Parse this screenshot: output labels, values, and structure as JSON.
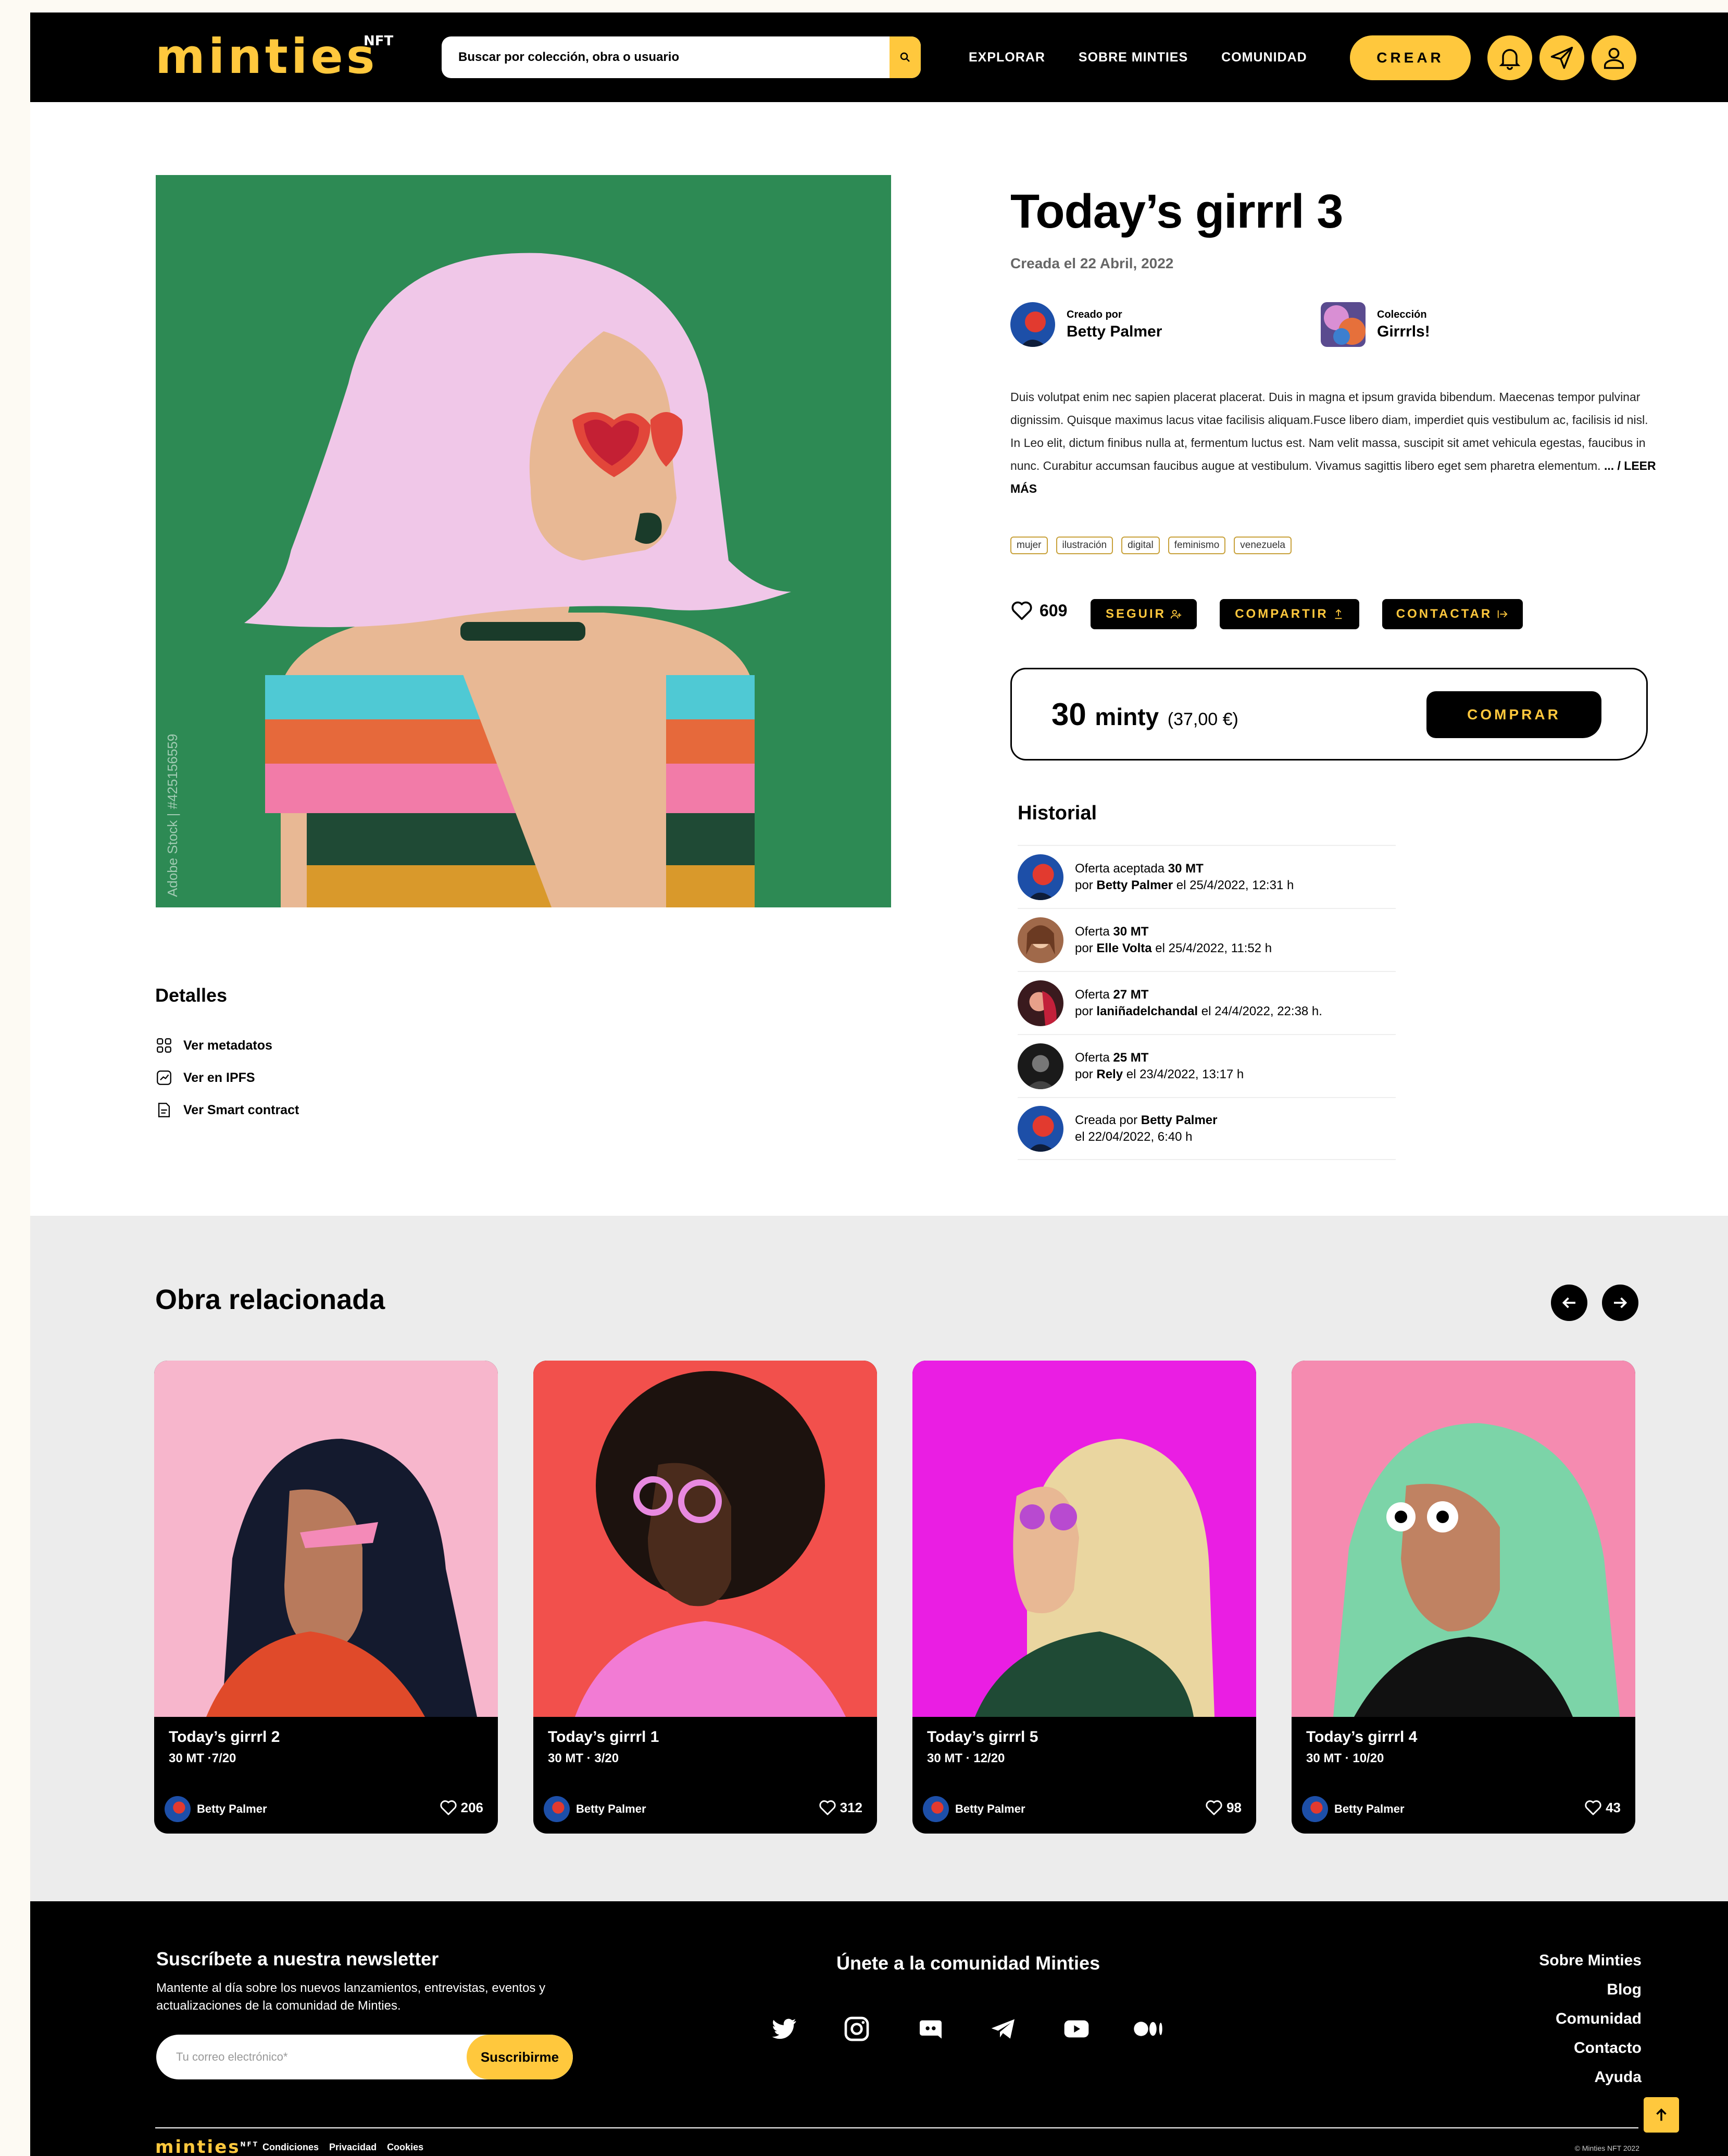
{
  "header": {
    "logo": "minties",
    "logo_sup": "NFT",
    "search_placeholder": "Buscar por colección, obra o usuario",
    "nav": [
      "EXPLORAR",
      "SOBRE MINTIES",
      "COMUNIDAD"
    ],
    "create_label": "CREAR",
    "icons": [
      "search-icon",
      "bell-icon",
      "send-icon",
      "user-icon"
    ]
  },
  "artwork": {
    "watermark": "Adobe Stock | #425156559",
    "background_color": "#2d8a54"
  },
  "details": {
    "title": "Detalles",
    "links": [
      "Ver metadatos",
      "Ver en IPFS",
      "Ver Smart contract"
    ]
  },
  "item": {
    "title": "Today’s girrrl 3",
    "created": "Creada el 22 Abril, 2022",
    "creator_label": "Creado por",
    "creator_name": "Betty Palmer",
    "collection_label": "Colección",
    "collection_name": "Girrrls!",
    "description": "Duis volutpat enim nec sapien placerat placerat. Duis in magna et ipsum gravida bibendum. Maecenas tempor pulvinar dignissim. Quisque maximus lacus vitae facilisis aliquam.Fusce libero diam, imperdiet quis vestibulum ac, facilisis id nisl. In Leo elit, dictum finibus nulla at, fermentum luctus est. Nam velit massa, suscipit sit amet vehicula egestas, faucibus in nunc. Curabitur accumsan faucibus augue at vestibulum. Vivamus sagittis libero eget sem pharetra elementum.",
    "read_more": "... / LEER MÁS",
    "tags": [
      "mujer",
      "ilustración",
      "digital",
      "feminismo",
      "venezuela"
    ],
    "likes": "609",
    "follow_label": "SEGUIR",
    "share_label": "COMPARTIR",
    "contact_label": "CONTACTAR",
    "price_amount": "30",
    "price_unit": "minty",
    "price_eur": "(37,00 €)",
    "buy_label": "COMPRAR"
  },
  "history": {
    "title": "Historial",
    "rows": [
      {
        "l1a": "Oferta aceptada ",
        "l1b": "30 MT",
        "l2a": "por ",
        "l2b": "Betty Palmer",
        "l2c": " el 25/4/2022, 12:31 h"
      },
      {
        "l1a": "Oferta ",
        "l1b": "30 MT",
        "l2a": "por ",
        "l2b": "Elle Volta",
        "l2c": " el 25/4/2022, 11:52 h"
      },
      {
        "l1a": "Oferta ",
        "l1b": "27 MT",
        "l2a": "por ",
        "l2b": "laniñadelchandal",
        "l2c": " el 24/4/2022, 22:38 h."
      },
      {
        "l1a": "Oferta ",
        "l1b": "25 MT",
        "l2a": "por ",
        "l2b": "Rely",
        "l2c": " el 23/4/2022, 13:17 h"
      },
      {
        "l1a": "Creada por ",
        "l1b": "Betty Palmer",
        "l2a": "el 22/04/2022, 6:40 h",
        "l2b": "",
        "l2c": ""
      }
    ]
  },
  "related": {
    "title": "Obra relacionada",
    "cards": [
      {
        "title": "Today’s girrrl 2",
        "meta": "30 MT ·7/20",
        "artist": "Betty Palmer",
        "likes": "206",
        "bg": "#f7b6cc"
      },
      {
        "title": "Today’s girrrl 1",
        "meta": "30 MT · 3/20",
        "artist": "Betty Palmer",
        "likes": "312",
        "bg": "#f2504c"
      },
      {
        "title": "Today’s girrrl 5",
        "meta": "30 MT · 12/20",
        "artist": "Betty Palmer",
        "likes": "98",
        "bg": "#ea1ee3"
      },
      {
        "title": "Today’s girrrl 4",
        "meta": "30 MT · 10/20",
        "artist": "Betty Palmer",
        "likes": "43",
        "bg": "#f58bb0"
      }
    ]
  },
  "footer": {
    "newsletter_title": "Suscríbete a nuestra newsletter",
    "newsletter_desc": "Mantente al día sobre los nuevos lanzamientos, entrevistas, eventos y actualizaciones de la comunidad de Minties.",
    "email_placeholder": "Tu correo electrónico*",
    "subscribe_label": "Suscribirme",
    "community_title": "Únete a la comunidad Minties",
    "social": [
      "twitter-icon",
      "instagram-icon",
      "discord-icon",
      "telegram-icon",
      "youtube-icon",
      "medium-icon"
    ],
    "links": [
      "Sobre Minties",
      "Blog",
      "Comunidad",
      "Contacto",
      "Ayuda"
    ],
    "logo": "minties",
    "logo_sup": "NFT",
    "legal": [
      "Condiciones",
      "Privacidad",
      "Cookies"
    ],
    "copyright": "© Minties NFT 2022"
  },
  "colors": {
    "accent": "#ffc83d",
    "dark": "#000000",
    "related_bg": "#ececec"
  }
}
